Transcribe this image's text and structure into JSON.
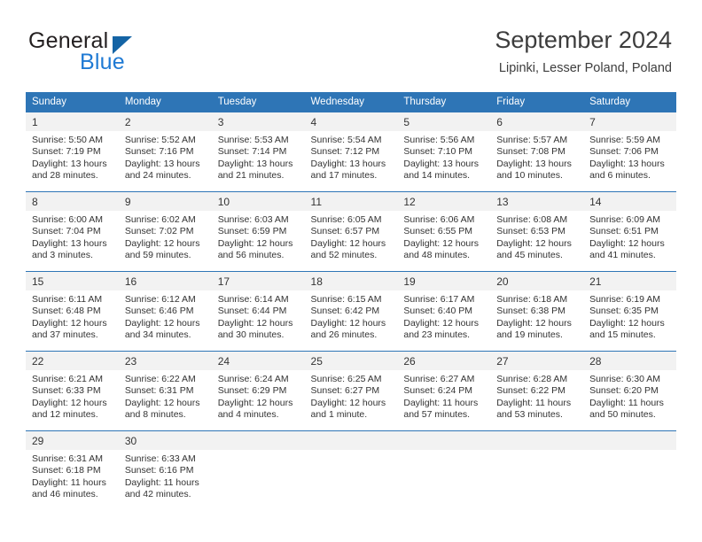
{
  "brand": {
    "name_part1": "General",
    "name_part2": "Blue",
    "triangle_color": "#1464a5",
    "blue_color": "#1f7ad4"
  },
  "header": {
    "month_title": "September 2024",
    "location": "Lipinki, Lesser Poland, Poland"
  },
  "theme": {
    "header_blue": "#2E75B6",
    "daynum_gray": "#F2F2F2",
    "text": "#333333"
  },
  "weekday_headers": [
    "Sunday",
    "Monday",
    "Tuesday",
    "Wednesday",
    "Thursday",
    "Friday",
    "Saturday"
  ],
  "weeks": [
    {
      "days": [
        {
          "date": "1",
          "sunrise": "Sunrise: 5:50 AM",
          "sunset": "Sunset: 7:19 PM",
          "daylight_1": "Daylight: 13 hours",
          "daylight_2": "and 28 minutes."
        },
        {
          "date": "2",
          "sunrise": "Sunrise: 5:52 AM",
          "sunset": "Sunset: 7:16 PM",
          "daylight_1": "Daylight: 13 hours",
          "daylight_2": "and 24 minutes."
        },
        {
          "date": "3",
          "sunrise": "Sunrise: 5:53 AM",
          "sunset": "Sunset: 7:14 PM",
          "daylight_1": "Daylight: 13 hours",
          "daylight_2": "and 21 minutes."
        },
        {
          "date": "4",
          "sunrise": "Sunrise: 5:54 AM",
          "sunset": "Sunset: 7:12 PM",
          "daylight_1": "Daylight: 13 hours",
          "daylight_2": "and 17 minutes."
        },
        {
          "date": "5",
          "sunrise": "Sunrise: 5:56 AM",
          "sunset": "Sunset: 7:10 PM",
          "daylight_1": "Daylight: 13 hours",
          "daylight_2": "and 14 minutes."
        },
        {
          "date": "6",
          "sunrise": "Sunrise: 5:57 AM",
          "sunset": "Sunset: 7:08 PM",
          "daylight_1": "Daylight: 13 hours",
          "daylight_2": "and 10 minutes."
        },
        {
          "date": "7",
          "sunrise": "Sunrise: 5:59 AM",
          "sunset": "Sunset: 7:06 PM",
          "daylight_1": "Daylight: 13 hours",
          "daylight_2": "and 6 minutes."
        }
      ]
    },
    {
      "days": [
        {
          "date": "8",
          "sunrise": "Sunrise: 6:00 AM",
          "sunset": "Sunset: 7:04 PM",
          "daylight_1": "Daylight: 13 hours",
          "daylight_2": "and 3 minutes."
        },
        {
          "date": "9",
          "sunrise": "Sunrise: 6:02 AM",
          "sunset": "Sunset: 7:02 PM",
          "daylight_1": "Daylight: 12 hours",
          "daylight_2": "and 59 minutes."
        },
        {
          "date": "10",
          "sunrise": "Sunrise: 6:03 AM",
          "sunset": "Sunset: 6:59 PM",
          "daylight_1": "Daylight: 12 hours",
          "daylight_2": "and 56 minutes."
        },
        {
          "date": "11",
          "sunrise": "Sunrise: 6:05 AM",
          "sunset": "Sunset: 6:57 PM",
          "daylight_1": "Daylight: 12 hours",
          "daylight_2": "and 52 minutes."
        },
        {
          "date": "12",
          "sunrise": "Sunrise: 6:06 AM",
          "sunset": "Sunset: 6:55 PM",
          "daylight_1": "Daylight: 12 hours",
          "daylight_2": "and 48 minutes."
        },
        {
          "date": "13",
          "sunrise": "Sunrise: 6:08 AM",
          "sunset": "Sunset: 6:53 PM",
          "daylight_1": "Daylight: 12 hours",
          "daylight_2": "and 45 minutes."
        },
        {
          "date": "14",
          "sunrise": "Sunrise: 6:09 AM",
          "sunset": "Sunset: 6:51 PM",
          "daylight_1": "Daylight: 12 hours",
          "daylight_2": "and 41 minutes."
        }
      ]
    },
    {
      "days": [
        {
          "date": "15",
          "sunrise": "Sunrise: 6:11 AM",
          "sunset": "Sunset: 6:48 PM",
          "daylight_1": "Daylight: 12 hours",
          "daylight_2": "and 37 minutes."
        },
        {
          "date": "16",
          "sunrise": "Sunrise: 6:12 AM",
          "sunset": "Sunset: 6:46 PM",
          "daylight_1": "Daylight: 12 hours",
          "daylight_2": "and 34 minutes."
        },
        {
          "date": "17",
          "sunrise": "Sunrise: 6:14 AM",
          "sunset": "Sunset: 6:44 PM",
          "daylight_1": "Daylight: 12 hours",
          "daylight_2": "and 30 minutes."
        },
        {
          "date": "18",
          "sunrise": "Sunrise: 6:15 AM",
          "sunset": "Sunset: 6:42 PM",
          "daylight_1": "Daylight: 12 hours",
          "daylight_2": "and 26 minutes."
        },
        {
          "date": "19",
          "sunrise": "Sunrise: 6:17 AM",
          "sunset": "Sunset: 6:40 PM",
          "daylight_1": "Daylight: 12 hours",
          "daylight_2": "and 23 minutes."
        },
        {
          "date": "20",
          "sunrise": "Sunrise: 6:18 AM",
          "sunset": "Sunset: 6:38 PM",
          "daylight_1": "Daylight: 12 hours",
          "daylight_2": "and 19 minutes."
        },
        {
          "date": "21",
          "sunrise": "Sunrise: 6:19 AM",
          "sunset": "Sunset: 6:35 PM",
          "daylight_1": "Daylight: 12 hours",
          "daylight_2": "and 15 minutes."
        }
      ]
    },
    {
      "days": [
        {
          "date": "22",
          "sunrise": "Sunrise: 6:21 AM",
          "sunset": "Sunset: 6:33 PM",
          "daylight_1": "Daylight: 12 hours",
          "daylight_2": "and 12 minutes."
        },
        {
          "date": "23",
          "sunrise": "Sunrise: 6:22 AM",
          "sunset": "Sunset: 6:31 PM",
          "daylight_1": "Daylight: 12 hours",
          "daylight_2": "and 8 minutes."
        },
        {
          "date": "24",
          "sunrise": "Sunrise: 6:24 AM",
          "sunset": "Sunset: 6:29 PM",
          "daylight_1": "Daylight: 12 hours",
          "daylight_2": "and 4 minutes."
        },
        {
          "date": "25",
          "sunrise": "Sunrise: 6:25 AM",
          "sunset": "Sunset: 6:27 PM",
          "daylight_1": "Daylight: 12 hours",
          "daylight_2": "and 1 minute."
        },
        {
          "date": "26",
          "sunrise": "Sunrise: 6:27 AM",
          "sunset": "Sunset: 6:24 PM",
          "daylight_1": "Daylight: 11 hours",
          "daylight_2": "and 57 minutes."
        },
        {
          "date": "27",
          "sunrise": "Sunrise: 6:28 AM",
          "sunset": "Sunset: 6:22 PM",
          "daylight_1": "Daylight: 11 hours",
          "daylight_2": "and 53 minutes."
        },
        {
          "date": "28",
          "sunrise": "Sunrise: 6:30 AM",
          "sunset": "Sunset: 6:20 PM",
          "daylight_1": "Daylight: 11 hours",
          "daylight_2": "and 50 minutes."
        }
      ]
    },
    {
      "days": [
        {
          "date": "29",
          "sunrise": "Sunrise: 6:31 AM",
          "sunset": "Sunset: 6:18 PM",
          "daylight_1": "Daylight: 11 hours",
          "daylight_2": "and 46 minutes."
        },
        {
          "date": "30",
          "sunrise": "Sunrise: 6:33 AM",
          "sunset": "Sunset: 6:16 PM",
          "daylight_1": "Daylight: 11 hours",
          "daylight_2": "and 42 minutes."
        },
        {
          "date": "",
          "sunrise": "",
          "sunset": "",
          "daylight_1": "",
          "daylight_2": ""
        },
        {
          "date": "",
          "sunrise": "",
          "sunset": "",
          "daylight_1": "",
          "daylight_2": ""
        },
        {
          "date": "",
          "sunrise": "",
          "sunset": "",
          "daylight_1": "",
          "daylight_2": ""
        },
        {
          "date": "",
          "sunrise": "",
          "sunset": "",
          "daylight_1": "",
          "daylight_2": ""
        },
        {
          "date": "",
          "sunrise": "",
          "sunset": "",
          "daylight_1": "",
          "daylight_2": ""
        }
      ]
    }
  ]
}
